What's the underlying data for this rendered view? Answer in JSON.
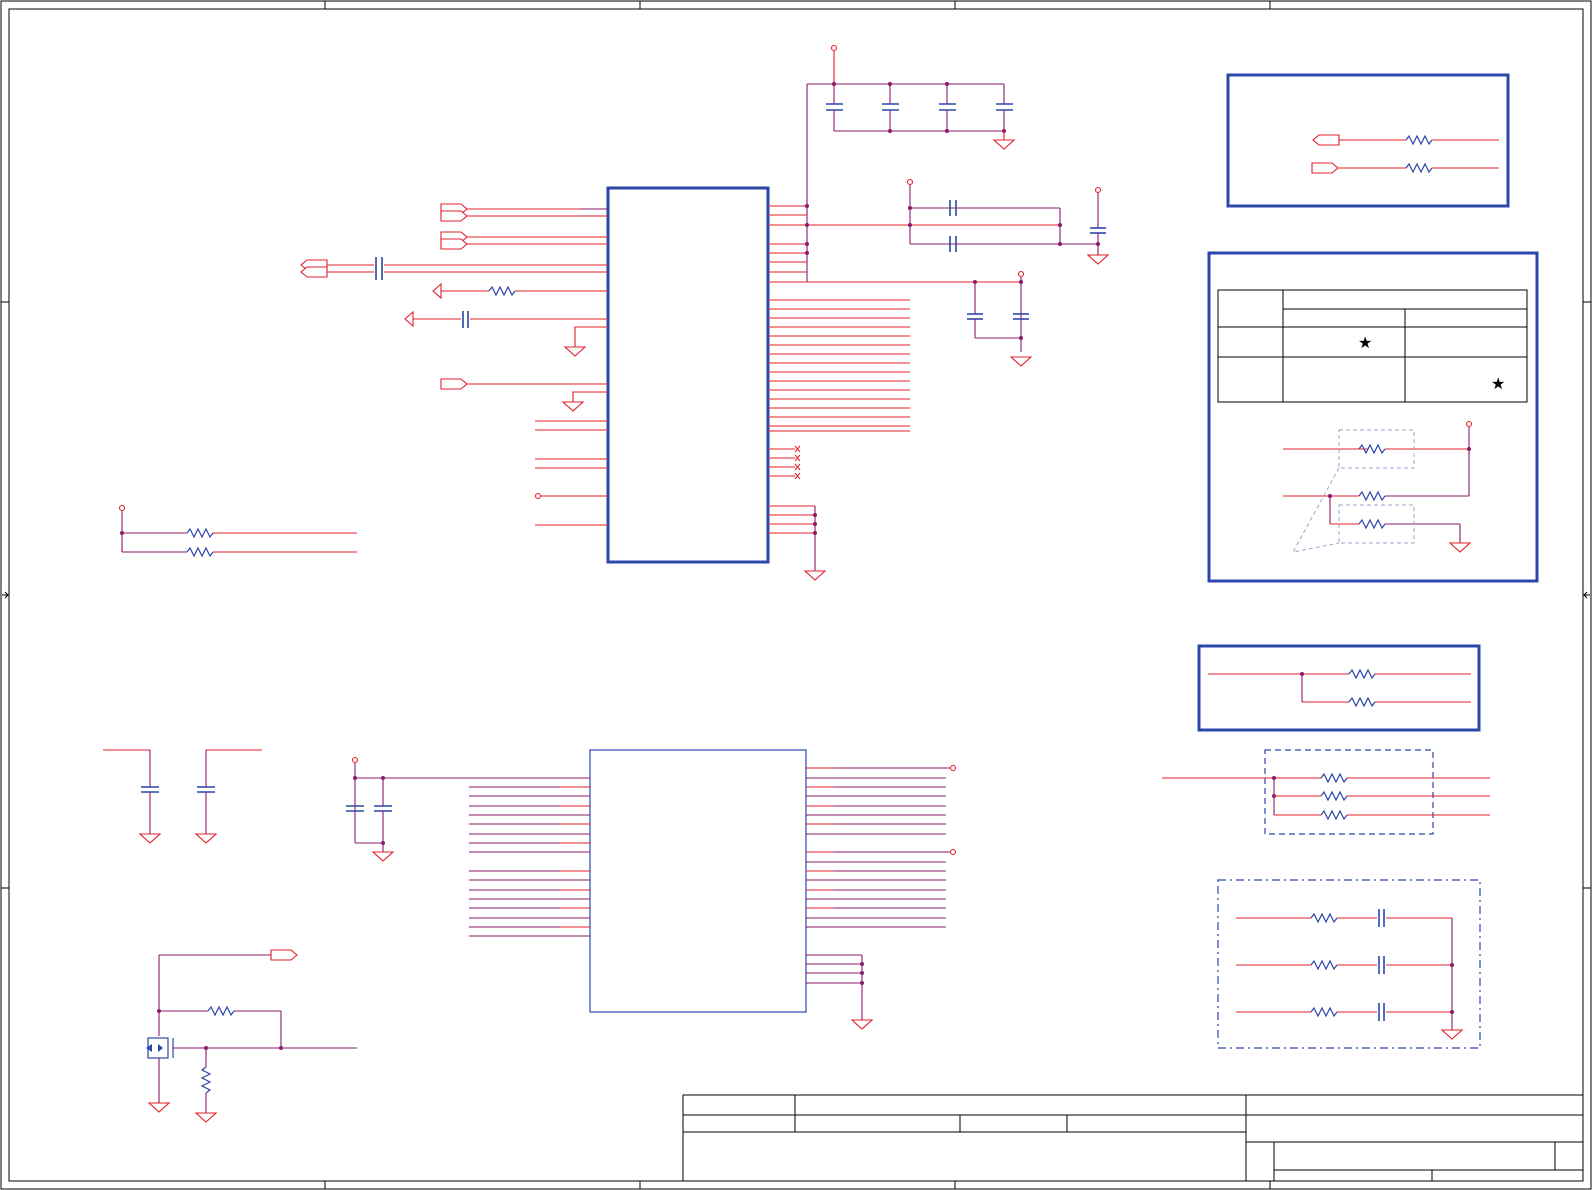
{
  "sheet": {
    "title": "",
    "colors": {
      "wire": "#e0202a",
      "junction": "#8b1a6a",
      "component": "#2b47a8",
      "frame": "#000000"
    },
    "icons": [
      "resistor-icon",
      "capacitor-icon",
      "ground-icon",
      "port-icon",
      "mosfet-icon",
      "star-icon",
      "no-connect-icon"
    ]
  },
  "option_table": {
    "marks": [
      "★",
      "★"
    ]
  }
}
